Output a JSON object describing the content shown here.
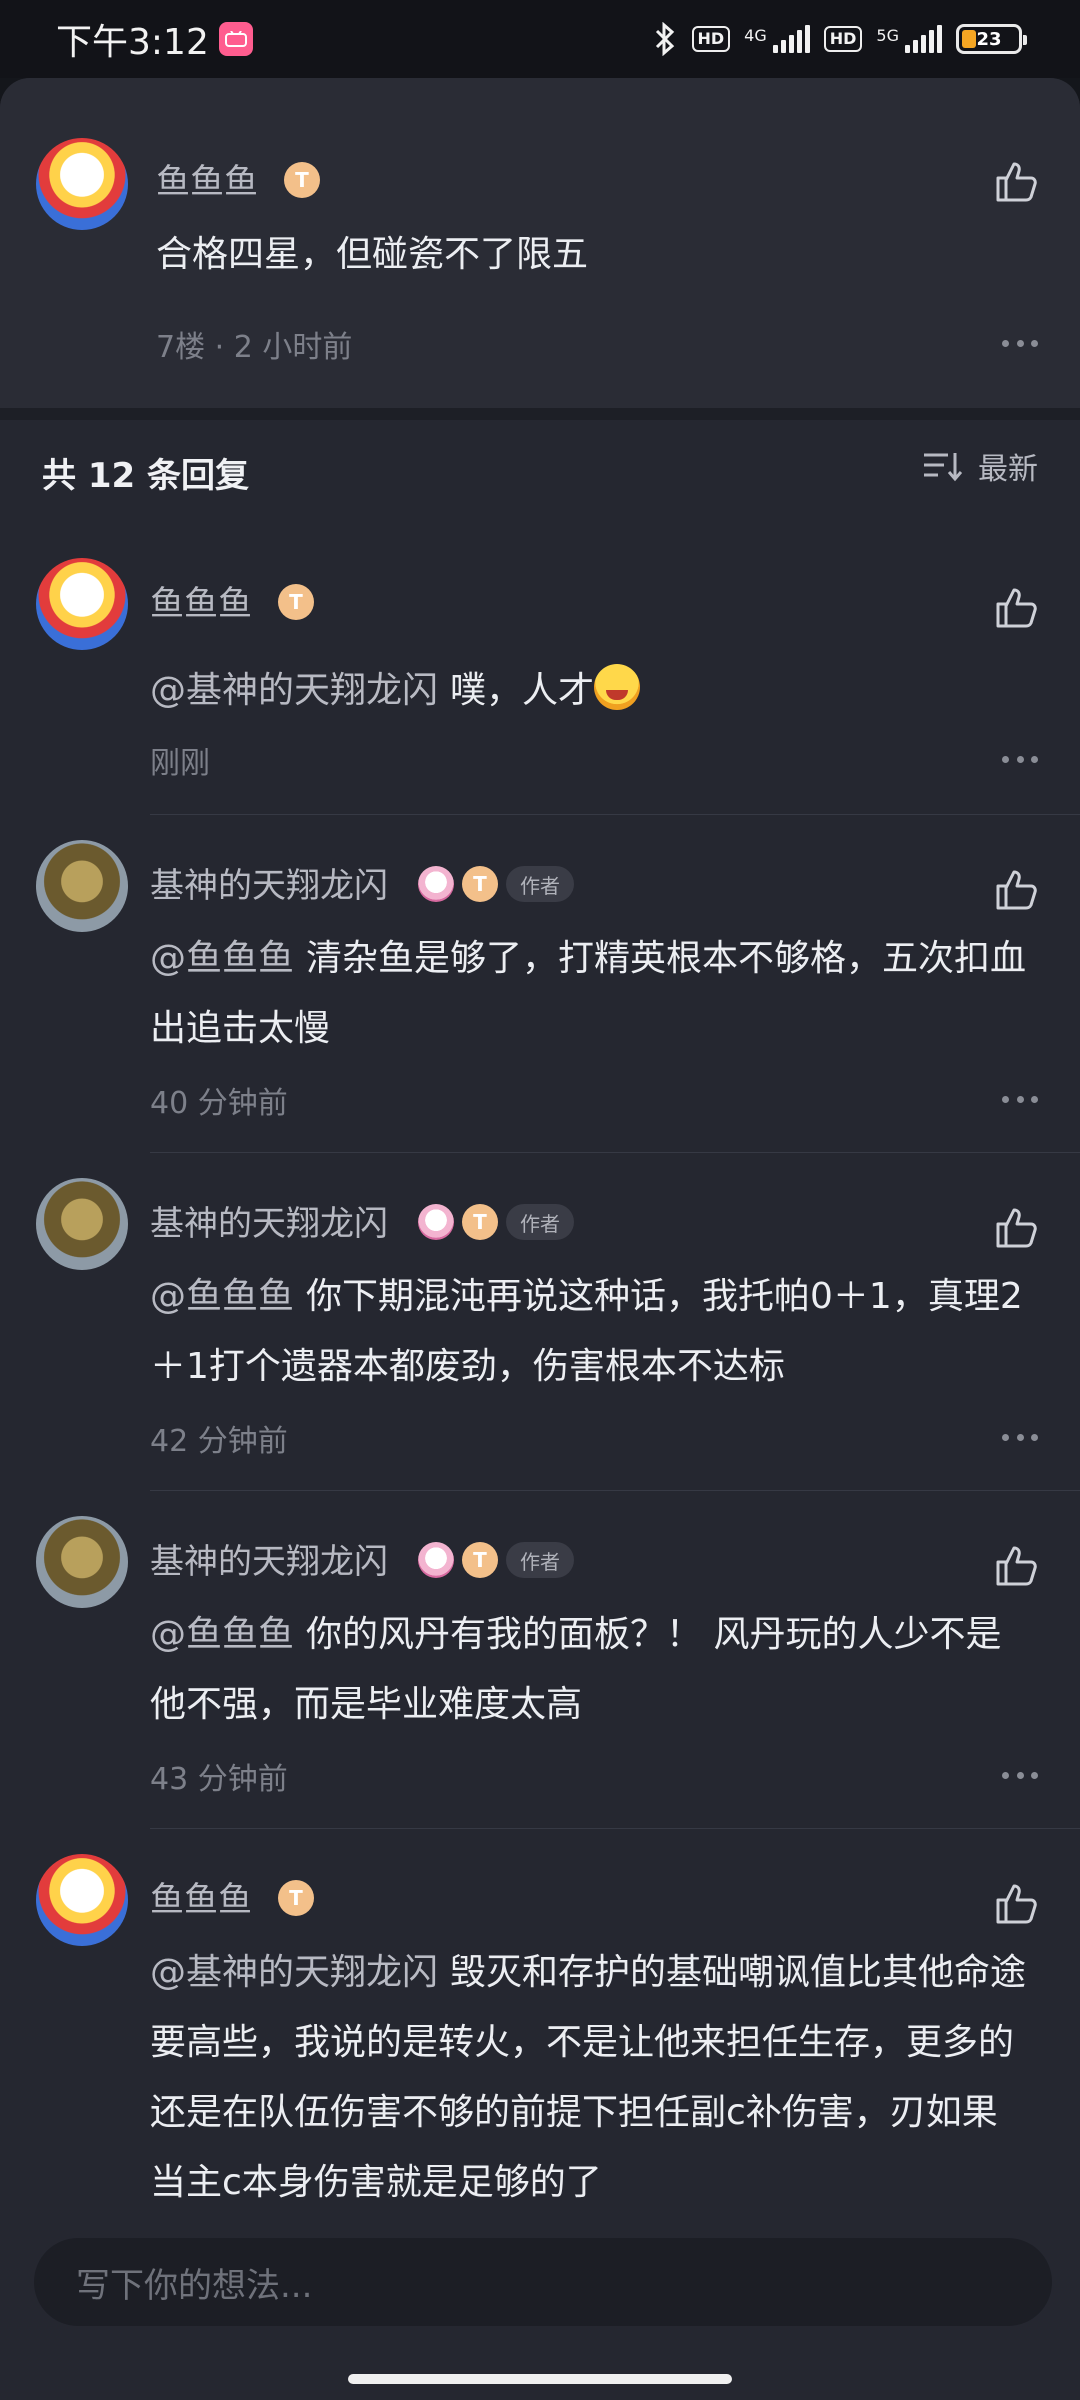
{
  "status_bar": {
    "time": "下午3:12",
    "app_badge": "bilibili",
    "hd1": "HD",
    "net1": "4G",
    "hd2": "HD",
    "net2": "5G",
    "battery": "23"
  },
  "parent_comment": {
    "user": "鱼鱼鱼",
    "medal": "T",
    "text": "合格四星，但碰瓷不了限五",
    "meta": "7楼 · 2 小时前"
  },
  "replies_header": {
    "title": "共 12 条回复",
    "sort_label": "最新"
  },
  "replies": [
    {
      "user": "鱼鱼鱼",
      "medal": "T",
      "mention": "@基神的天翔龙闪",
      "text": "噗，人才",
      "meta": "刚刚"
    },
    {
      "user": "基神的天翔龙闪",
      "medal": "T",
      "author_tag": "作者",
      "mention": "@鱼鱼鱼",
      "text": "清杂鱼是够了，打精英根本不够格，五次扣血出追击太慢",
      "meta": "40 分钟前"
    },
    {
      "user": "基神的天翔龙闪",
      "medal": "T",
      "author_tag": "作者",
      "mention": "@鱼鱼鱼",
      "text": "你下期混沌再说这种话，我托帕0＋1，真理2＋1打个遗器本都废劲，伤害根本不达标",
      "meta": "42 分钟前"
    },
    {
      "user": "基神的天翔龙闪",
      "medal": "T",
      "author_tag": "作者",
      "mention": "@鱼鱼鱼",
      "text": "你的风丹有我的面板？！ 风丹玩的人少不是他不强，而是毕业难度太高",
      "meta": "43 分钟前"
    },
    {
      "user": "鱼鱼鱼",
      "medal": "T",
      "mention": "@基神的天翔龙闪",
      "text": "毁灭和存护的基础嘲讽值比其他命途要高些，我说的是转火，不是让他来担任生存，更多的还是在队伍伤害不够的前提下担任副c补伤害，刃如果当主c本身伤害就是足够的了",
      "meta": ""
    }
  ],
  "input": {
    "placeholder": "写下你的想法..."
  }
}
